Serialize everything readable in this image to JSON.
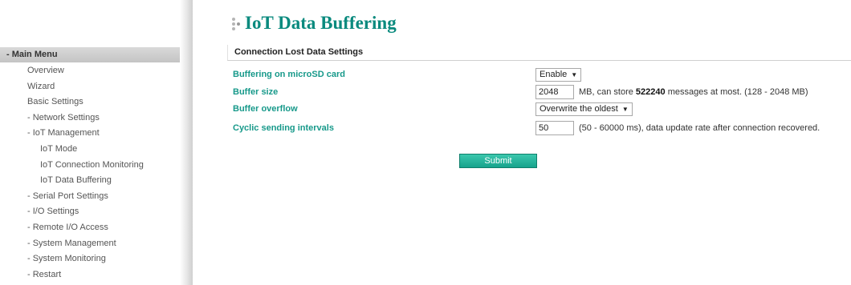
{
  "page": {
    "title": "IoT Data Buffering"
  },
  "sidebar": {
    "header": "- Main Menu",
    "items": [
      {
        "label": "Overview",
        "level": 1
      },
      {
        "label": "Wizard",
        "level": 1
      },
      {
        "label": "Basic Settings",
        "level": 1
      },
      {
        "label": "- Network Settings",
        "level": 1
      },
      {
        "label": "- IoT Management",
        "level": 1
      },
      {
        "label": "IoT Mode",
        "level": 2
      },
      {
        "label": "IoT Connection Monitoring",
        "level": 2
      },
      {
        "label": "IoT Data Buffering",
        "level": 2
      },
      {
        "label": "- Serial Port Settings",
        "level": 1
      },
      {
        "label": "- I/O Settings",
        "level": 1
      },
      {
        "label": "- Remote I/O Access",
        "level": 1
      },
      {
        "label": "- System Management",
        "level": 1
      },
      {
        "label": "- System Monitoring",
        "level": 1
      },
      {
        "label": "- Restart",
        "level": 1
      }
    ]
  },
  "section": {
    "title": "Connection Lost Data Settings"
  },
  "form": {
    "buffering": {
      "label": "Buffering on microSD card",
      "value": "Enable"
    },
    "buffer_size": {
      "label": "Buffer size",
      "value": "2048",
      "hint_prefix": "MB, can store",
      "hint_count": "522240",
      "hint_suffix": "messages at most. (128 - 2048 MB)"
    },
    "buffer_overflow": {
      "label": "Buffer overflow",
      "value": "Overwrite the oldest"
    },
    "cyclic": {
      "label": "Cyclic sending intervals",
      "value": "50",
      "hint": "(50 - 60000 ms), data update rate after connection recovered."
    }
  },
  "submit_label": "Submit",
  "colors": {
    "accent": "#17998a",
    "title": "#0a8a7e",
    "button": "#1fae95"
  }
}
